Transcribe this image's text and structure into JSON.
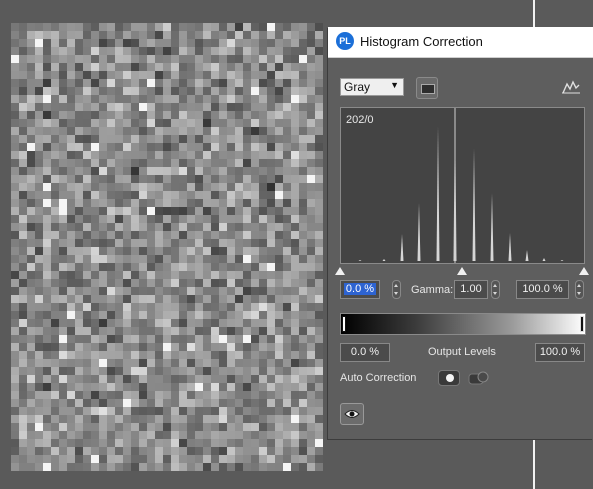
{
  "dialog": {
    "title": "Histogram Correction",
    "app_icon": "PL"
  },
  "toolbar": {
    "channel": "Gray",
    "channel_options": [
      "Gray"
    ],
    "icons": [
      "dropdown-arrow-icon",
      "reset-icon",
      "histogram-icon"
    ]
  },
  "histogram": {
    "readout": "202/0"
  },
  "input_levels": {
    "black": "0.0 %",
    "gamma_label": "Gamma:",
    "gamma": "1.00",
    "white": "100.0 %"
  },
  "output_levels": {
    "label": "Output Levels",
    "black": "0.0 %",
    "white": "100.0 %"
  },
  "auto_correction": {
    "label": "Auto Correction"
  },
  "colors": {
    "accent": "#2d63d1",
    "dialog_bg": "#5e5e5e",
    "histogram_bg": "#444444"
  }
}
